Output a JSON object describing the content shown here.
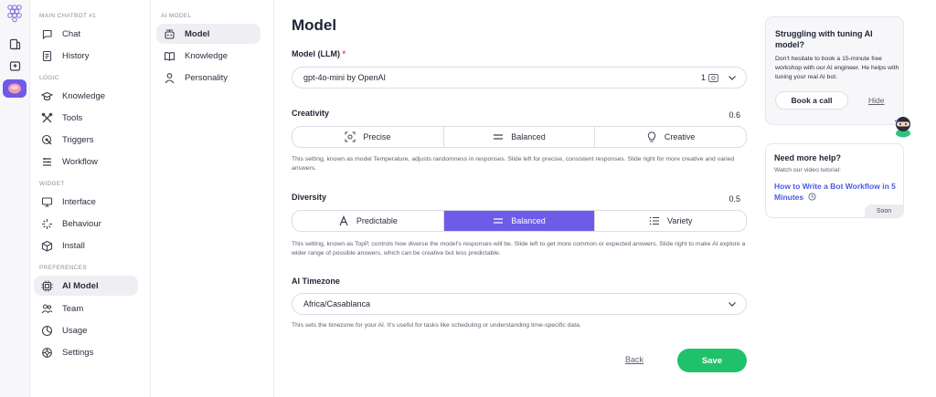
{
  "colors": {
    "accent": "#6c5ce7",
    "save": "#1fc16b",
    "link": "#4a5ae8",
    "required": "#e5484d"
  },
  "rail": {
    "logo_icon": "grape-logo-icon",
    "buttons": [
      "book-icon",
      "inbox-icon",
      "avatar-icon"
    ]
  },
  "sidebar": {
    "chatbot_title": "MAIN CHATBOT #1",
    "main_items": [
      {
        "label": "Chat",
        "icon": "chat-bubble-icon"
      },
      {
        "label": "History",
        "icon": "document-icon"
      }
    ],
    "logic_title": "LOGIC",
    "logic_items": [
      {
        "label": "Knowledge",
        "icon": "graduation-cap-icon"
      },
      {
        "label": "Tools",
        "icon": "tools-icon"
      },
      {
        "label": "Triggers",
        "icon": "trigger-icon"
      },
      {
        "label": "Workflow",
        "icon": "workflow-icon"
      }
    ],
    "widget_title": "WIDGET",
    "widget_items": [
      {
        "label": "Interface",
        "icon": "monitor-icon"
      },
      {
        "label": "Behaviour",
        "icon": "sparkle-icon"
      },
      {
        "label": "Install",
        "icon": "cube-icon"
      }
    ],
    "preferences_title": "PREFERENCES",
    "preferences_items": [
      {
        "label": "AI Model",
        "icon": "chip-icon",
        "active": true
      },
      {
        "label": "Team",
        "icon": "team-icon"
      },
      {
        "label": "Usage",
        "icon": "pie-icon"
      },
      {
        "label": "Settings",
        "icon": "gear-icon"
      }
    ]
  },
  "subnav": {
    "title": "AI MODEL",
    "items": [
      {
        "label": "Model",
        "icon": "robot-icon",
        "active": true
      },
      {
        "label": "Knowledge",
        "icon": "open-book-icon"
      },
      {
        "label": "Personality",
        "icon": "person-icon"
      }
    ]
  },
  "main": {
    "title": "Model",
    "llm": {
      "label": "Model (LLM)",
      "required_mark": "*",
      "value": "gpt-4o-mini by OpenAI",
      "credits": "1"
    },
    "creativity": {
      "label": "Creativity",
      "value": "0.6",
      "options": [
        {
          "label": "Precise",
          "icon": "target-icon"
        },
        {
          "label": "Balanced",
          "icon": "equals-icon"
        },
        {
          "label": "Creative",
          "icon": "lightbulb-icon"
        }
      ],
      "help": "This setting, known as model Temperature, adjusts randomness in responses. Slide left for precise, consistent responses. Slide right for more creative and varied answers."
    },
    "diversity": {
      "label": "Diversity",
      "value": "0.5",
      "options": [
        {
          "label": "Predictable",
          "icon": "letter-a-icon"
        },
        {
          "label": "Balanced",
          "icon": "equals-icon",
          "active": true
        },
        {
          "label": "Variety",
          "icon": "list-icon"
        }
      ],
      "help": "This setting, known as TopP, controls how diverse the model's responses will be. Slide left to get more common or expected answers. Slide right to make AI explore a wider range of possible answers, which can be creative but less predictable."
    },
    "timezone": {
      "label": "AI Timezone",
      "value": "Africa/Casablanca",
      "help": "This sets the timezone for your AI. It's useful for tasks like scheduling or understanding time-specific data."
    },
    "back_label": "Back",
    "save_label": "Save"
  },
  "right": {
    "card1": {
      "title": "Struggling with tuning AI model?",
      "body": "Don't hesitate to book a 15-minute free workshop with our AI engineer. He helps with tuning your real AI bot.",
      "book_label": "Book a call",
      "hide_label": "Hide"
    },
    "card2": {
      "title": "Need more help?",
      "subtitle": "Watch our video tutorial:",
      "link": "How to Write a Bot Workflow in 5 Minutes",
      "badge": "Soon"
    }
  }
}
